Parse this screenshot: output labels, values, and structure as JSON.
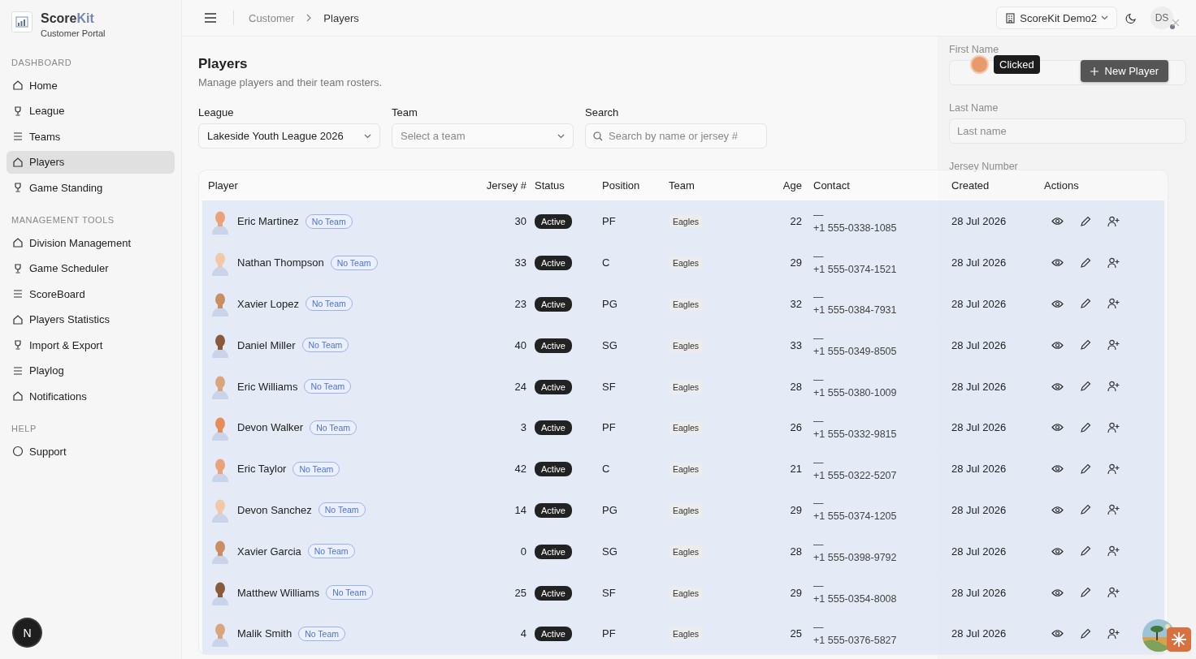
{
  "sidebar": {
    "brand_main": "Score",
    "brand_accent": "Kit",
    "subtitle": "Customer Portal",
    "sections": [
      {
        "title": "DASHBOARD",
        "items": [
          {
            "label": "Home",
            "selected": false
          },
          {
            "label": "League",
            "selected": false
          },
          {
            "label": "Teams",
            "selected": false
          },
          {
            "label": "Players",
            "selected": true
          },
          {
            "label": "Game Standing",
            "selected": false
          }
        ]
      },
      {
        "title": "MANAGEMENT TOOLS",
        "items": [
          {
            "label": "Division Management",
            "selected": false
          },
          {
            "label": "Game Scheduler",
            "selected": false
          },
          {
            "label": "ScoreBoard",
            "selected": false
          },
          {
            "label": "Players Statistics",
            "selected": false
          },
          {
            "label": "Import & Export",
            "selected": false
          },
          {
            "label": "Playlog",
            "selected": false
          },
          {
            "label": "Notifications",
            "selected": false
          }
        ]
      },
      {
        "title": "HELP",
        "items": [
          {
            "label": "Support",
            "selected": false
          }
        ]
      }
    ],
    "dev_badge": "N"
  },
  "header": {
    "breadcrumb": [
      "Customer",
      "Players"
    ],
    "workspace": "ScoreKit Demo2",
    "user_initials": "DS"
  },
  "page": {
    "title": "Players",
    "subtitle": "Manage players and their team rosters.",
    "new_button": "New Player",
    "filters": [
      {
        "label": "League",
        "kind": "select",
        "value": "Lakeside Youth League 2026"
      },
      {
        "label": "Team",
        "kind": "select",
        "placeholder": "Select a team"
      },
      {
        "label": "Search",
        "kind": "search",
        "placeholder": "Search by name or jersey #"
      }
    ]
  },
  "table": {
    "columns": [
      "Player",
      "Jersey #",
      "Status",
      "Position",
      "Team",
      "Age",
      "Contact",
      "Created",
      "Actions"
    ],
    "rows": [
      {
        "name": "Eric Martinez",
        "tag": "No Team",
        "jersey": "30",
        "status": "Active",
        "position": "PF",
        "team": "Eagles",
        "age": "22",
        "email": "—",
        "phone": "+1 555-0338-1085",
        "created": "28 Jul 2026"
      },
      {
        "name": "Nathan Thompson",
        "tag": "No Team",
        "jersey": "33",
        "status": "Active",
        "position": "C",
        "team": "Eagles",
        "age": "29",
        "email": "—",
        "phone": "+1 555-0374-1521",
        "created": "28 Jul 2026"
      },
      {
        "name": "Xavier Lopez",
        "tag": "No Team",
        "jersey": "23",
        "status": "Active",
        "position": "PG",
        "team": "Eagles",
        "age": "32",
        "email": "—",
        "phone": "+1 555-0384-7931",
        "created": "28 Jul 2026"
      },
      {
        "name": "Daniel Miller",
        "tag": "No Team",
        "jersey": "40",
        "status": "Active",
        "position": "SG",
        "team": "Eagles",
        "age": "33",
        "email": "—",
        "phone": "+1 555-0349-8505",
        "created": "28 Jul 2026"
      },
      {
        "name": "Eric Williams",
        "tag": "No Team",
        "jersey": "24",
        "status": "Active",
        "position": "SF",
        "team": "Eagles",
        "age": "28",
        "email": "—",
        "phone": "+1 555-0380-1009",
        "created": "28 Jul 2026"
      },
      {
        "name": "Devon Walker",
        "tag": "No Team",
        "jersey": "3",
        "status": "Active",
        "position": "PF",
        "team": "Eagles",
        "age": "26",
        "email": "—",
        "phone": "+1 555-0332-9815",
        "created": "28 Jul 2026"
      },
      {
        "name": "Eric Taylor",
        "tag": "No Team",
        "jersey": "42",
        "status": "Active",
        "position": "C",
        "team": "Eagles",
        "age": "21",
        "email": "—",
        "phone": "+1 555-0322-5207",
        "created": "28 Jul 2026"
      },
      {
        "name": "Devon Sanchez",
        "tag": "No Team",
        "jersey": "14",
        "status": "Active",
        "position": "PG",
        "team": "Eagles",
        "age": "29",
        "email": "—",
        "phone": "+1 555-0374-1205",
        "created": "28 Jul 2026"
      },
      {
        "name": "Xavier Garcia",
        "tag": "No Team",
        "jersey": "0",
        "status": "Active",
        "position": "SG",
        "team": "Eagles",
        "age": "28",
        "email": "—",
        "phone": "+1 555-0398-9792",
        "created": "28 Jul 2026"
      },
      {
        "name": "Matthew Williams",
        "tag": "No Team",
        "jersey": "25",
        "status": "Active",
        "position": "SF",
        "team": "Eagles",
        "age": "29",
        "email": "—",
        "phone": "+1 555-0354-8008",
        "created": "28 Jul 2026"
      },
      {
        "name": "Malik Smith",
        "tag": "No Team",
        "jersey": "4",
        "status": "Active",
        "position": "PF",
        "team": "Eagles",
        "age": "25",
        "email": "—",
        "phone": "+1 555-0376-5827",
        "created": "28 Jul 2026"
      }
    ]
  },
  "drawer": {
    "fields": [
      {
        "label": "First Name"
      },
      {
        "label": "Last Name",
        "placeholder": "Last name"
      },
      {
        "label": "Jersey Number"
      }
    ]
  },
  "click_marker": {
    "label": "Clicked"
  }
}
